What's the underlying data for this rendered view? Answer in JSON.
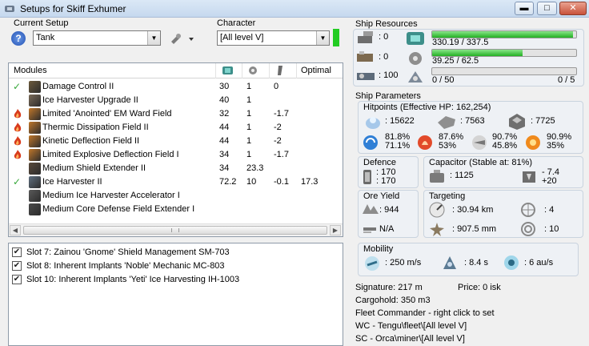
{
  "window": {
    "title": "Setups for Skiff Exhumer",
    "buttons": {
      "minimize": "▬",
      "maximize": "□",
      "close": "✕"
    }
  },
  "setup": {
    "label": "Current Setup",
    "value": "Tank",
    "help": "?"
  },
  "character": {
    "label": "Character",
    "value": "[All level V]",
    "indicator_color": "#22cc22"
  },
  "modules": {
    "headers": {
      "name": "Modules",
      "optimal": "Optimal"
    },
    "rows": [
      {
        "status": "check",
        "name": "Damage Control II",
        "c1": "30",
        "c2": "1",
        "c3": "0",
        "c4": ""
      },
      {
        "status": "",
        "name": "Ice Harvester Upgrade II",
        "c1": "40",
        "c2": "1",
        "c3": "",
        "c4": ""
      },
      {
        "status": "fire",
        "name": "Limited 'Anointed' EM Ward Field",
        "c1": "32",
        "c2": "1",
        "c3": "-1.7",
        "c4": ""
      },
      {
        "status": "fire",
        "name": "Thermic Dissipation Field II",
        "c1": "44",
        "c2": "1",
        "c3": "-2",
        "c4": ""
      },
      {
        "status": "fire",
        "name": "Kinetic Deflection Field II",
        "c1": "44",
        "c2": "1",
        "c3": "-2",
        "c4": ""
      },
      {
        "status": "fire",
        "name": "Limited Explosive Deflection Field I",
        "c1": "34",
        "c2": "1",
        "c3": "-1.7",
        "c4": ""
      },
      {
        "status": "",
        "name": "Medium Shield Extender II",
        "c1": "34",
        "c2": "23.3",
        "c3": "",
        "c4": ""
      },
      {
        "status": "check",
        "name": "Ice Harvester II",
        "c1": "72.2",
        "c2": "10",
        "c3": "-0.1",
        "c4": "17.3"
      },
      {
        "status": "",
        "name": "Medium Ice Harvester Accelerator I",
        "c1": "",
        "c2": "",
        "c3": "",
        "c4": ""
      },
      {
        "status": "",
        "name": "Medium Core Defense Field Extender I",
        "c1": "",
        "c2": "",
        "c3": "",
        "c4": ""
      }
    ]
  },
  "implants": [
    {
      "checked": true,
      "label": "Slot 7: Zainou 'Gnome' Shield Management SM-703"
    },
    {
      "checked": true,
      "label": "Slot 8: Inherent Implants 'Noble' Mechanic MC-803"
    },
    {
      "checked": true,
      "label": "Slot 10: Inherent Implants 'Yeti' Ice Harvesting IH-1003"
    }
  ],
  "resources": {
    "label": "Ship Resources",
    "left": [
      ": 0",
      ": 0",
      ": 100"
    ],
    "cpu": {
      "text": "330.19 / 337.5",
      "fraction": 0.978
    },
    "power": {
      "text": "39.25 / 62.5",
      "fraction": 0.628
    },
    "drone": {
      "text": "0 / 50",
      "right": "0 / 5",
      "fraction": 0
    }
  },
  "params": {
    "label": "Ship Parameters",
    "hitpoints": {
      "label": "Hitpoints (Effective HP: 162,254)",
      "shield": ": 15622",
      "armor": ": 7563",
      "hull": ": 7725",
      "res": [
        {
          "a": "81.8%",
          "b": "71.1%"
        },
        {
          "a": "87.6%",
          "b": "53%"
        },
        {
          "a": "90.7%",
          "b": "45.8%"
        },
        {
          "a": "90.9%",
          "b": "35%"
        }
      ]
    },
    "defence": {
      "label": "Defence",
      "a": ": 170",
      "b": ": 170"
    },
    "capacitor": {
      "label": "Capacitor (Stable at: 81%)",
      "cap": ": 1125",
      "a": "- 7.4",
      "b": "+20"
    },
    "ore": {
      "label": "Ore Yield",
      "a": ": 944",
      "b": "N/A"
    },
    "targeting": {
      "label": "Targeting",
      "range": ": 30.94 km",
      "targets": ": 4",
      "sig": ": 907.5 mm",
      "scan": ": 10"
    },
    "mobility": {
      "label": "Mobility",
      "speed": ": 250 m/s",
      "align": ": 8.4 s",
      "warp": ": 6 au/s"
    }
  },
  "footer": {
    "signature": "Signature: 217 m",
    "price": "Price: 0 isk",
    "cargo": "Cargohold: 350 m3",
    "fleet": "Fleet Commander - right click to set",
    "wc": "WC - Tengu\\fleet\\[All level V]",
    "sc": "SC - Orca\\miner\\[All level V]"
  }
}
